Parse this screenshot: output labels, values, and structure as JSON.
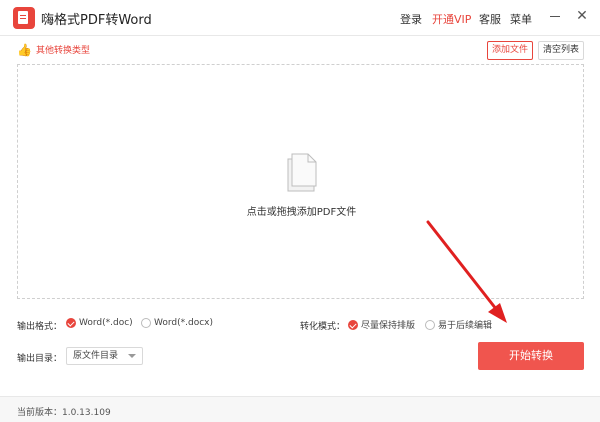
{
  "app": {
    "title": "嗨格式PDF转Word"
  },
  "menu": {
    "login": "登录",
    "vip": "开通VIP",
    "service": "客服",
    "menu": "菜单"
  },
  "toolbar": {
    "other_types": "其他转换类型",
    "add_file": "添加文件",
    "clear_list": "清空列表"
  },
  "dropzone": {
    "hint": "点击或拖拽添加PDF文件"
  },
  "output_format": {
    "label": "输出格式：",
    "options": [
      {
        "label": "Word(*.doc)",
        "selected": true
      },
      {
        "label": "Word(*.docx)",
        "selected": false
      }
    ]
  },
  "convert_mode": {
    "label": "转化模式：",
    "options": [
      {
        "label": "尽量保持排版",
        "selected": true
      },
      {
        "label": "易于后续编辑",
        "selected": false
      }
    ]
  },
  "output_dir": {
    "label": "输出目录：",
    "value": "原文件目录"
  },
  "start_button": "开始转换",
  "status": {
    "version": "当前版本：1.0.13.109"
  },
  "colors": {
    "accent": "#e8453c",
    "button": "#f0554e",
    "annotation_arrow": "#e02020"
  },
  "icons": {
    "logo": "pdf-doc-icon",
    "other_types": "thumb-up-icon",
    "files": "documents-icon",
    "minimize": "minimize-icon",
    "close": "close-icon"
  }
}
